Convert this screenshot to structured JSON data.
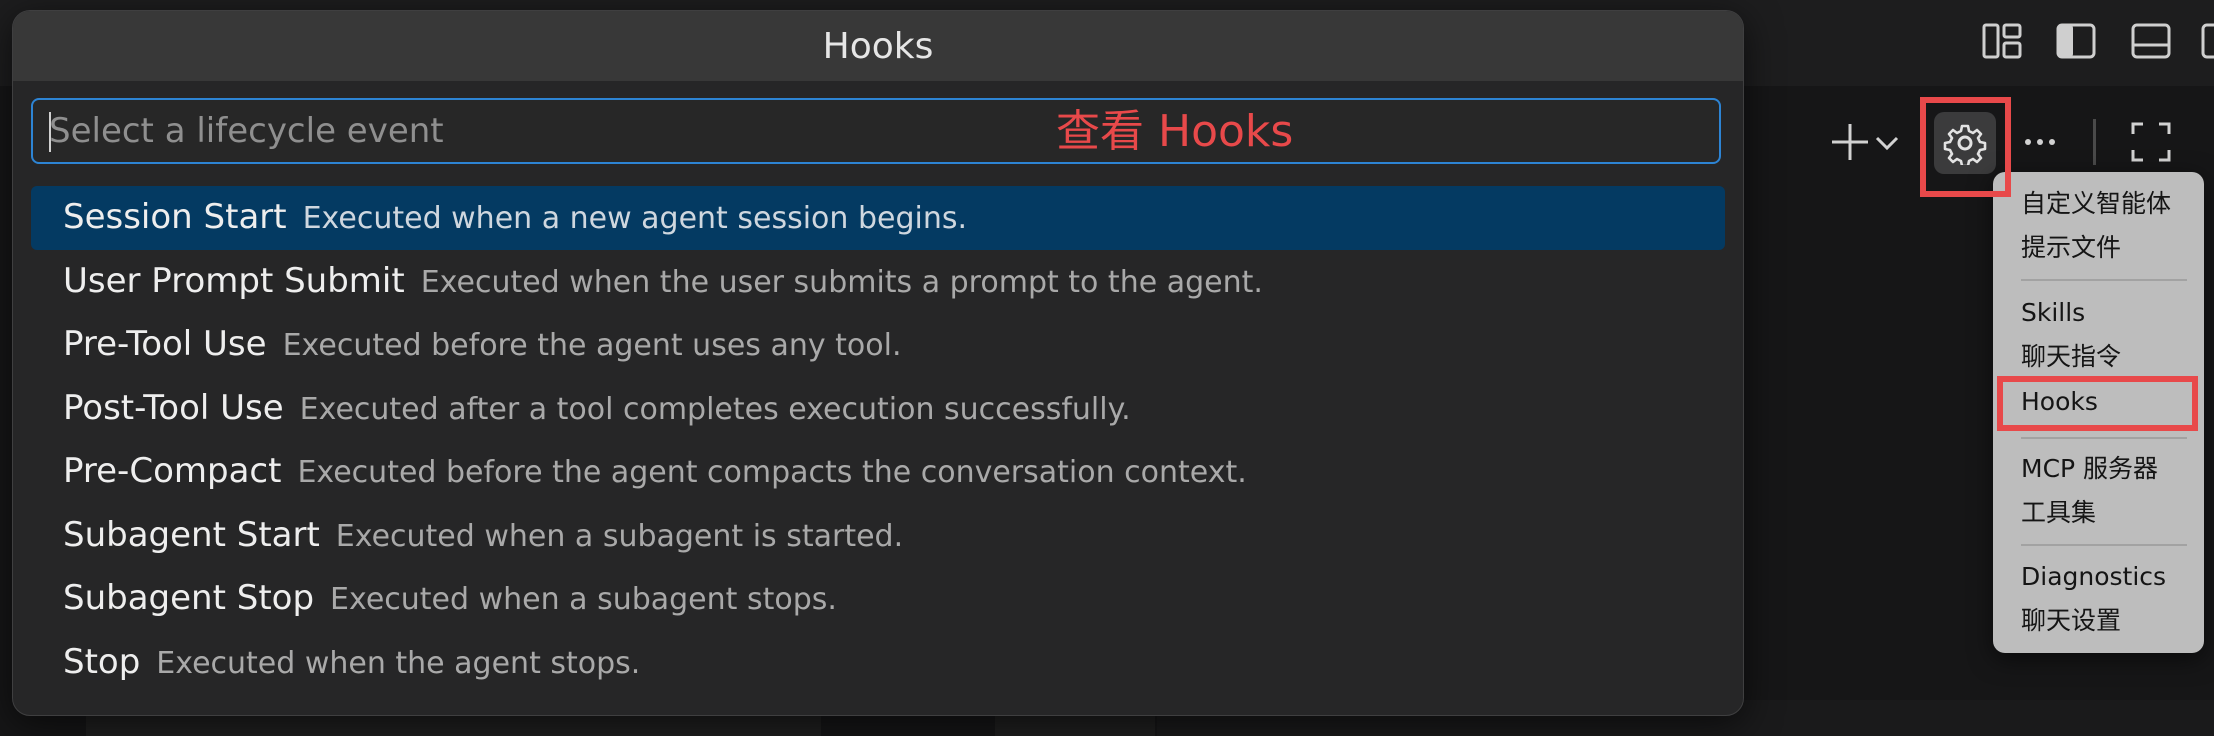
{
  "dialog": {
    "title": "Hooks",
    "input_placeholder": "Select a lifecycle event",
    "items": [
      {
        "label": "Session Start",
        "description": "Executed when a new agent session begins."
      },
      {
        "label": "User Prompt Submit",
        "description": "Executed when the user submits a prompt to the agent."
      },
      {
        "label": "Pre-Tool Use",
        "description": "Executed before the agent uses any tool."
      },
      {
        "label": "Post-Tool Use",
        "description": "Executed after a tool completes execution successfully."
      },
      {
        "label": "Pre-Compact",
        "description": "Executed before the agent compacts the conversation context."
      },
      {
        "label": "Subagent Start",
        "description": "Executed when a subagent is started."
      },
      {
        "label": "Subagent Stop",
        "description": "Executed when a subagent stops."
      },
      {
        "label": "Stop",
        "description": "Executed when the agent stops."
      }
    ]
  },
  "annotation": {
    "text": "查看 Hooks",
    "color": "#e8494a"
  },
  "menu": {
    "groups": [
      [
        "自定义智能体",
        "提示文件"
      ],
      [
        "Skills",
        "聊天指令",
        "Hooks"
      ],
      [
        "MCP 服务器",
        "工具集"
      ],
      [
        "Diagnostics",
        "聊天设置"
      ]
    ],
    "highlighted_item": "Hooks"
  },
  "toolbar": {
    "icons": [
      "add-icon",
      "chevron-down-icon",
      "gear-icon",
      "more-icon",
      "fullscreen-icon"
    ]
  },
  "layout_icons": [
    "customize-layout-icon",
    "toggle-sidebar-icon",
    "toggle-panel-icon",
    "toggle-secondary-sidebar-icon"
  ],
  "colors": {
    "accent": "#2d84d4",
    "selection": "#043a62",
    "annotation": "#e8494a"
  }
}
